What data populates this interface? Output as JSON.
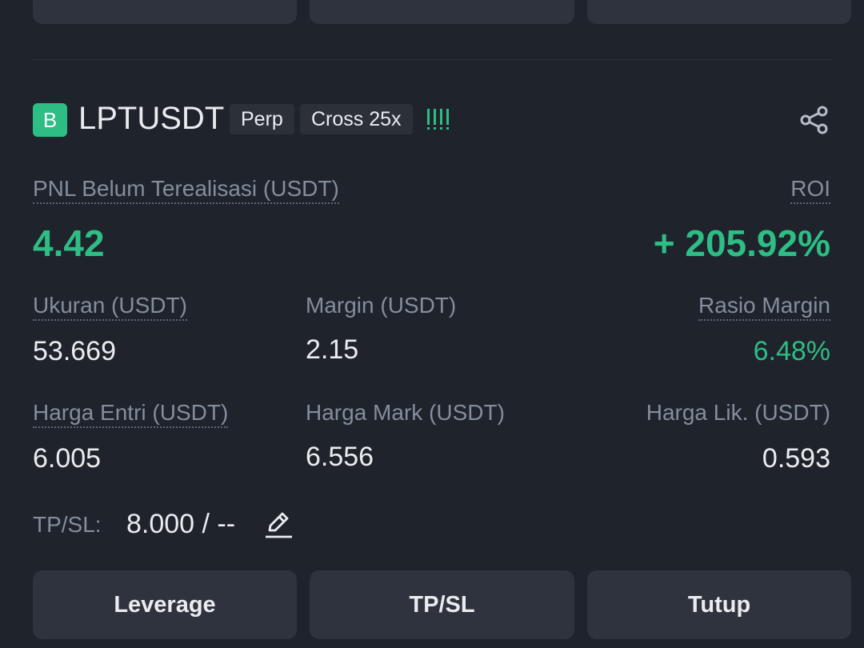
{
  "position": {
    "side": "B",
    "symbol": "LPTUSDT",
    "tags": [
      "Perp",
      "Cross 25x"
    ],
    "pnl": {
      "label": "PNL Belum Terealisasi (USDT)",
      "value": "4.42"
    },
    "roi": {
      "label": "ROI",
      "value": "+ 205.92%"
    },
    "size": {
      "label": "Ukuran (USDT)",
      "value": "53.669"
    },
    "margin": {
      "label": "Margin (USDT)",
      "value": "2.15"
    },
    "margin_ratio": {
      "label": "Rasio Margin",
      "value": "6.48%"
    },
    "entry_price": {
      "label": "Harga Entri (USDT)",
      "value": "6.005"
    },
    "mark_price": {
      "label": "Harga Mark (USDT)",
      "value": "6.556"
    },
    "liq_price": {
      "label": "Harga Lik. (USDT)",
      "value": "0.593"
    },
    "tpsl": {
      "label": "TP/SL:",
      "value": "8.000 / --"
    }
  },
  "actions": {
    "leverage": "Leverage",
    "tpsl": "TP/SL",
    "close": "Tutup"
  },
  "colors": {
    "background": "#1f232b",
    "green": "#2ebd85",
    "muted": "#848e9c",
    "button": "#2e333e"
  },
  "icons": [
    "share-icon",
    "edit-icon",
    "margin-level-icon"
  ]
}
